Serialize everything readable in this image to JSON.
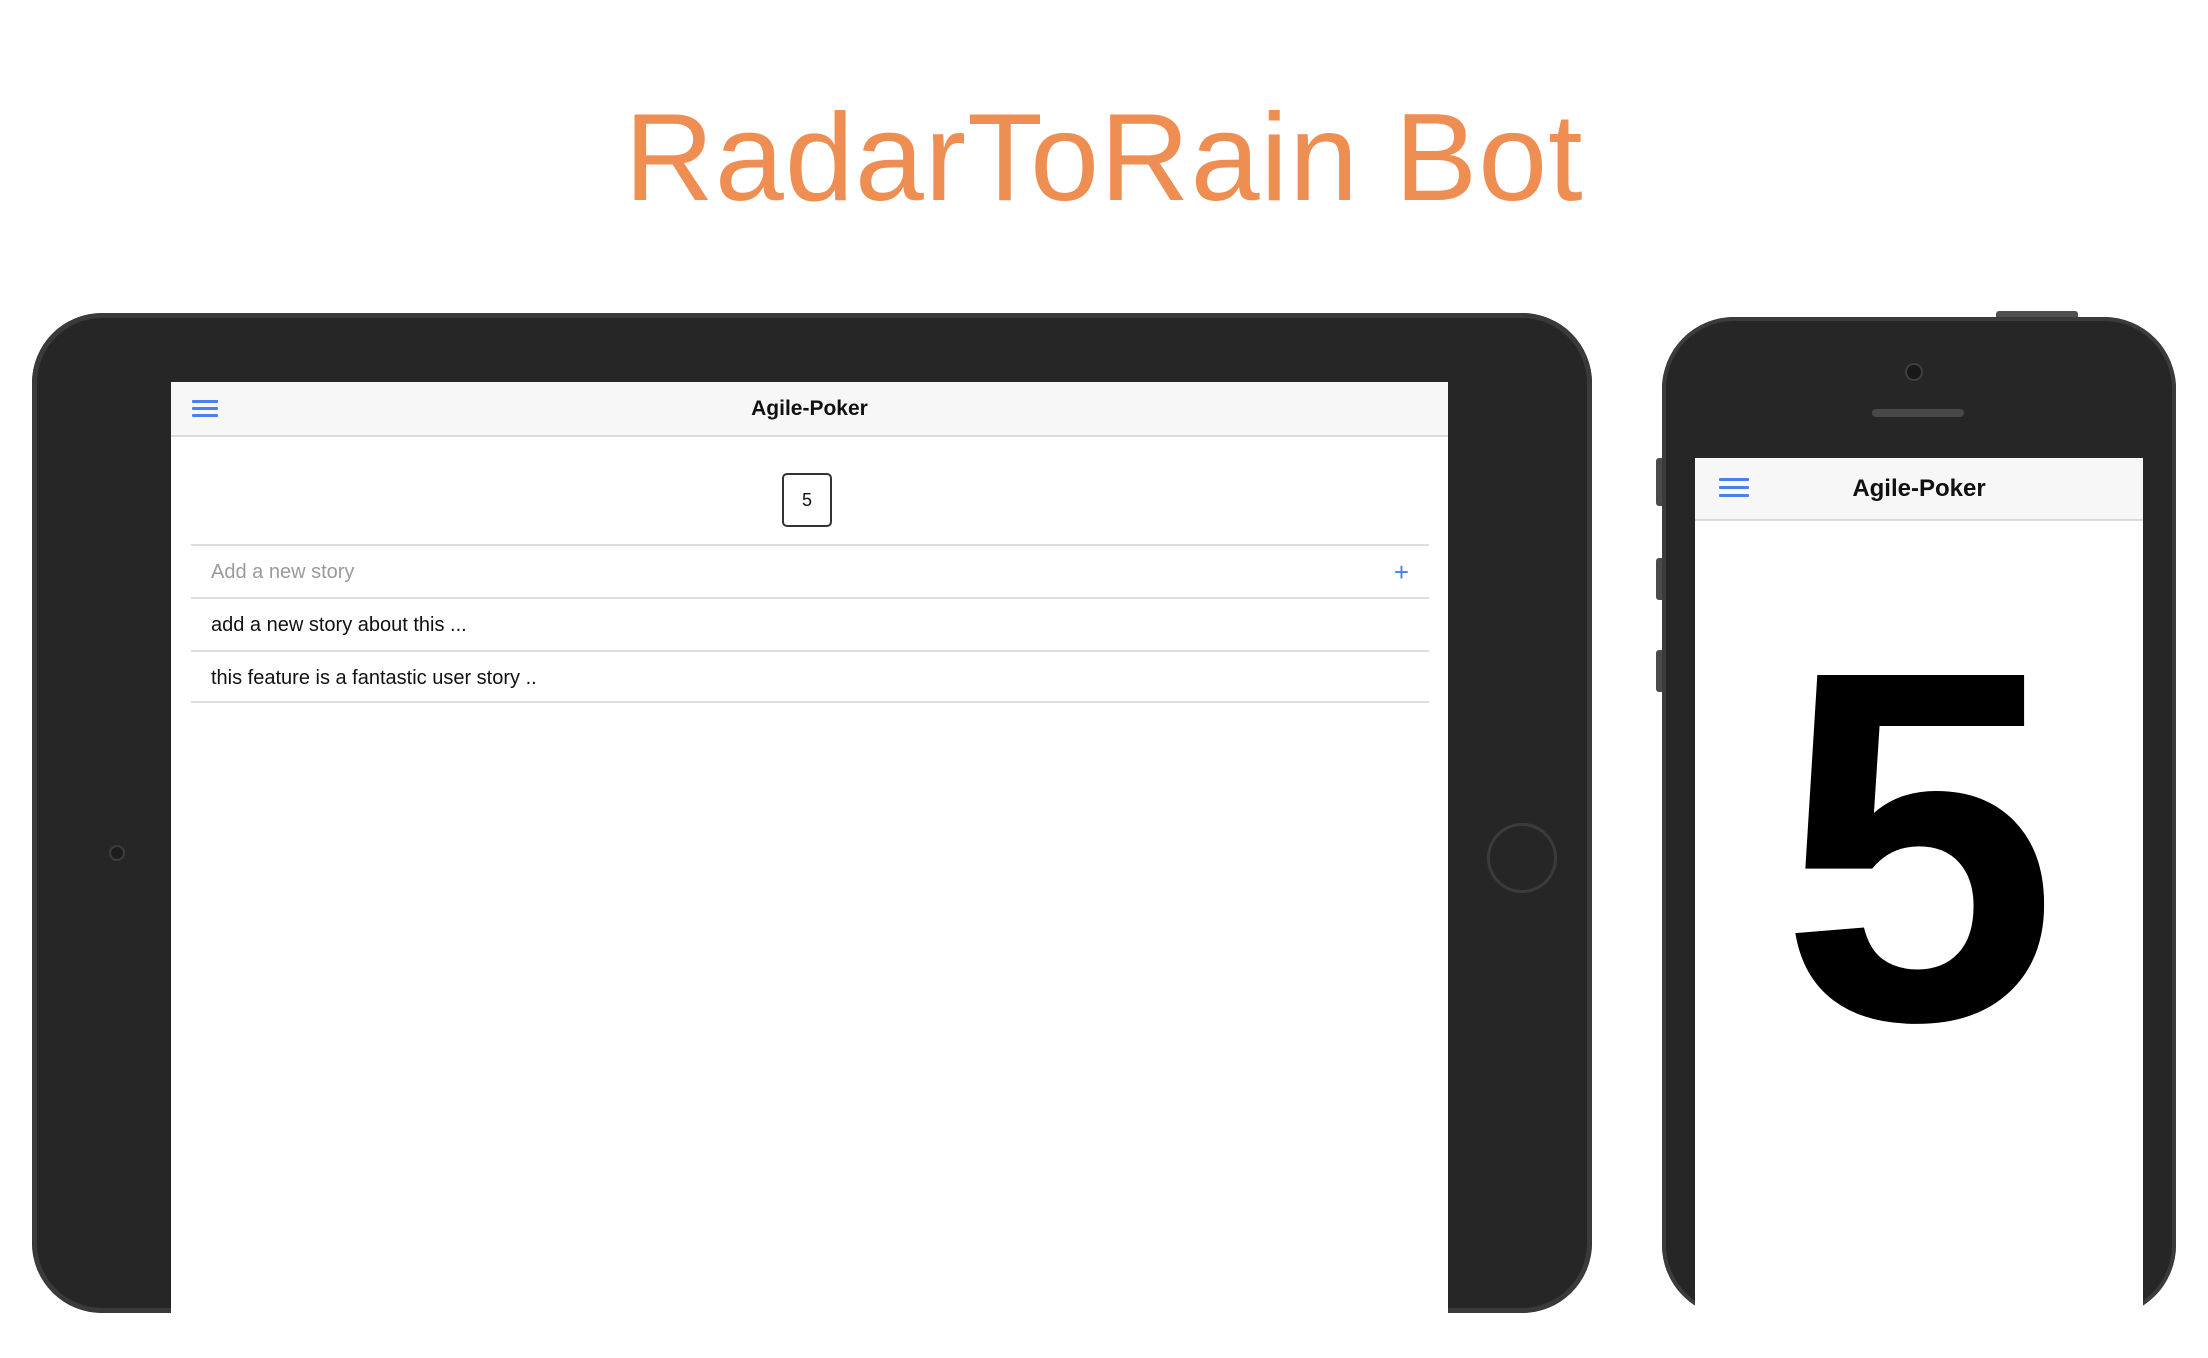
{
  "headline": "RadarToRain Bot",
  "tablet": {
    "app_title": "Agile-Poker",
    "menu_icon": "hamburger-menu-icon",
    "selected_vote": "5",
    "new_story": {
      "placeholder": "Add a new story",
      "value": "",
      "add_symbol": "+"
    },
    "stories": [
      "add a new story about this ...",
      "this feature is a fantastic user story .."
    ]
  },
  "phone": {
    "app_title": "Agile-Poker",
    "menu_icon": "hamburger-menu-icon",
    "vote_display": "5"
  },
  "colors": {
    "headline": "#ef8e53",
    "accent": "#4a7ff0",
    "device_body": "#262626"
  }
}
